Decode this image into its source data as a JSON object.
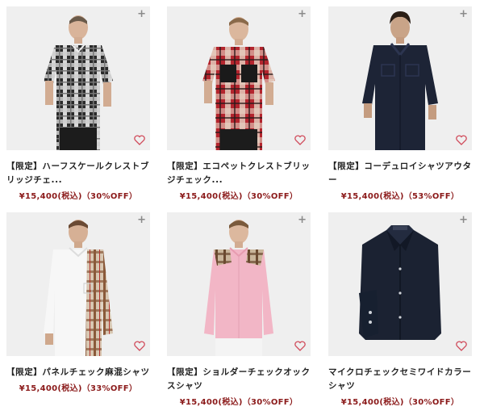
{
  "products": [
    {
      "title": "【限定】ハーフスケールクレストブリッジチェ...",
      "price": "¥15,400(税込)（30%OFF）",
      "image": "Short-sleeve black and white check shirt"
    },
    {
      "title": "【限定】エコペットクレストブリッジチェック...",
      "price": "¥15,400(税込)（30%OFF）",
      "image": "Short-sleeve red check shirt with black pockets"
    },
    {
      "title": "【限定】コーデュロイシャツアウター",
      "price": "¥15,400(税込)（53%OFF）",
      "image": "Navy corduroy shirt jacket"
    },
    {
      "title": "【限定】パネルチェック麻混シャツ",
      "price": "¥15,400(税込)（33%OFF）",
      "image": "White shirt with check panel"
    },
    {
      "title": "【限定】ショルダーチェックオックスシャツ",
      "price": "¥15,400(税込)（30%OFF）",
      "image": "Pink oxford shirt with check shoulders"
    },
    {
      "title": "マイクロチェックセミワイドカラーシャツ",
      "price": "¥15,400(税込)（30%OFF）",
      "image": "Navy micro check semi-wide collar shirt"
    }
  ],
  "icons": {
    "plus": "plus-icon",
    "favorite": "heart-icon"
  },
  "colors": {
    "price": "#8b1a1a",
    "heart": "#d04a5a",
    "card_bg": "#efefef"
  }
}
